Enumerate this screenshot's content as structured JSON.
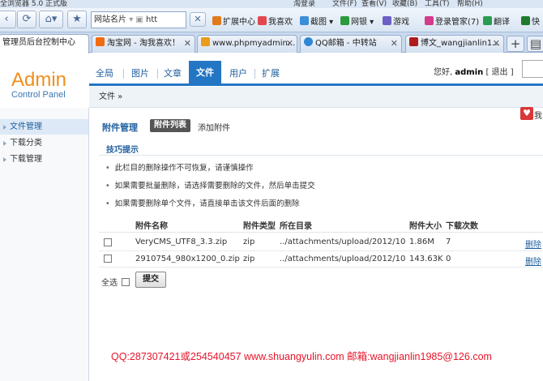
{
  "browser": {
    "title_fragments": [
      "全浏览器 5.0 正式版",
      "淘登录",
      "文件(F)",
      "查看(V)",
      "收藏(B)",
      "工具(T)",
      "帮助(H)"
    ],
    "toolbar": {
      "address": "网站名片",
      "url_partial": "htt",
      "items": [
        "扩展中心",
        "我喜欢",
        "截图",
        "网银",
        "游戏",
        "登录管家(7)",
        "翻译",
        "快"
      ]
    },
    "tabs": [
      {
        "label": "管理员后台控制中心",
        "active": true
      },
      {
        "label": "淘宝网 - 淘我喜欢！",
        "active": false
      },
      {
        "label": "www.phpmyadmin...",
        "active": false
      },
      {
        "label": "QQ邮箱 - 中转站",
        "active": false
      },
      {
        "label": "博文_wangjianlin1...",
        "active": false
      }
    ],
    "new_tab": "+"
  },
  "logo": {
    "title": "Admin",
    "subtitle": "Control Panel"
  },
  "nav": {
    "items": [
      "全局",
      "图片",
      "文章",
      "文件",
      "用户",
      "扩展"
    ],
    "active": "文件"
  },
  "user": {
    "greeting": "您好,",
    "name": "admin",
    "logout": "[ 退出 ]"
  },
  "breadcrumb": "文件 »",
  "sidebar": {
    "items": [
      {
        "label": "文件管理",
        "active": true
      },
      {
        "label": "下载分类",
        "active": false
      },
      {
        "label": "下载管理",
        "active": false
      }
    ]
  },
  "favorite": {
    "icon": "heart-icon",
    "label": "我"
  },
  "main": {
    "title": "附件管理",
    "tab_list": "附件列表",
    "tab_add": "添加附件",
    "tips_title": "技巧提示",
    "tips": [
      "此栏目的删除操作不可恢复，请谨慎操作",
      "如果需要批量删除，请选择需要删除的文件，然后单击提交",
      "如果需要删除单个文件，请直接单击该文件后面的删除"
    ],
    "table": {
      "headers": [
        "附件名称",
        "附件类型",
        "所在目录",
        "附件大小",
        "下载次数"
      ],
      "rows": [
        {
          "name": "VeryCMS_UTF8_3.3.zip",
          "type": "zip",
          "dir": "../attachments/upload/2012/10",
          "size": "1.86M",
          "downloads": "7",
          "action": "删除"
        },
        {
          "name": "2910754_980x1200_0.zip",
          "type": "zip",
          "dir": "../attachments/upload/2012/10",
          "size": "143.63K",
          "downloads": "0",
          "action": "删除"
        }
      ]
    },
    "select_all": "全选",
    "submit": "提交"
  },
  "watermark": "QQ:287307421或254540457 www.shuangyulin.com 邮箱:wangjianlin1985@126.com",
  "colors": {
    "accent": "#2376c4",
    "logo": "#f08e1d",
    "watermark": "#e8142a"
  }
}
